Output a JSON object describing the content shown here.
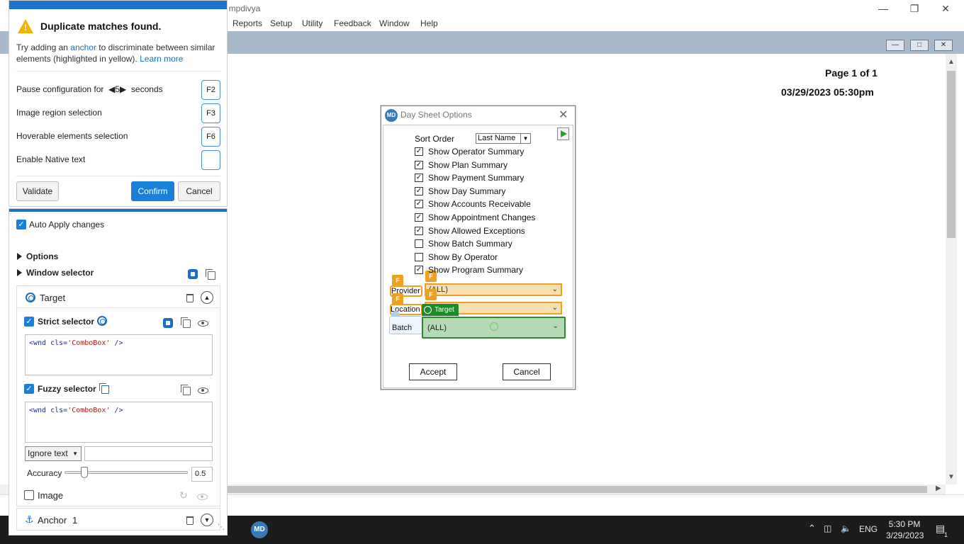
{
  "app": {
    "title": "t mpdivya",
    "menu": [
      "Reports",
      "Setup",
      "Utility",
      "Feedback",
      "Window",
      "Help"
    ],
    "report_page": "Page 1 of 1",
    "report_date": "03/29/2023 05:30pm"
  },
  "taskbar": {
    "md_label": "MD",
    "lang": "ENG",
    "time": "5:30 PM",
    "date": "3/29/2023",
    "notification_count": "1"
  },
  "dialog": {
    "title": "Day Sheet Options",
    "logo": "MD",
    "sort_label": "Sort Order",
    "sort_value": "Last Name",
    "options": [
      {
        "label": "Show Operator Summary",
        "checked": true
      },
      {
        "label": "Show Plan Summary",
        "checked": true
      },
      {
        "label": "Show Payment Summary",
        "checked": true
      },
      {
        "label": "Show Day Summary",
        "checked": true
      },
      {
        "label": "Show Accounts Receivable",
        "checked": true
      },
      {
        "label": "Show Appointment Changes",
        "checked": true
      },
      {
        "label": "Show Allowed Exceptions",
        "checked": true
      },
      {
        "label": "Show Batch Summary",
        "checked": false
      },
      {
        "label": "Show By Operator",
        "checked": false
      },
      {
        "label": "Show Program Summary",
        "checked": true
      }
    ],
    "provider_label": "Provider",
    "provider_value": "(ALL)",
    "location_label": "Location",
    "location_value": "",
    "batch_label": "Batch",
    "batch_value": "(ALL)",
    "flag_letter": "F",
    "target_tag": "Target",
    "accept_label": "Accept",
    "cancel_label": "Cancel"
  },
  "panel": {
    "warning_title": "Duplicate matches found.",
    "warning_pre": "Try adding an ",
    "warning_link": "anchor",
    "warning_post": " to discriminate between similar elements (highlighted in yellow). ",
    "learn_more": "Learn more",
    "pause_pre": "Pause configuration for",
    "pause_value": "5",
    "pause_post": "seconds",
    "pause_key": "F2",
    "image_region": "Image region selection",
    "image_region_key": "F3",
    "hoverable": "Hoverable elements selection",
    "hoverable_key": "F6",
    "native_text": "Enable Native text",
    "native_text_key": "",
    "validate": "Validate",
    "confirm": "Confirm",
    "cancel": "Cancel",
    "auto_apply": "Auto Apply changes",
    "options": "Options",
    "window_selector": "Window selector",
    "target": "Target",
    "strict_selector": "Strict selector",
    "strict_code_pre": "<wnd cls=",
    "strict_code_val": "'ComboBox'",
    "strict_code_post": " />",
    "fuzzy_selector": "Fuzzy selector",
    "fuzzy_code_pre": "<wnd cls=",
    "fuzzy_code_val": "'ComboBox'",
    "fuzzy_code_post": " />",
    "ignore_text": "Ignore text",
    "accuracy_label": "Accuracy",
    "accuracy_value": "0.5",
    "accuracy": 0.5,
    "image": "Image",
    "anchor": "Anchor",
    "anchor_count": "1"
  },
  "colors": {
    "accent": "#1a7fd9",
    "highlight_orange": "#f0a020",
    "target_green": "#1f8a2a",
    "mdi_band": "#a9b9cc"
  }
}
